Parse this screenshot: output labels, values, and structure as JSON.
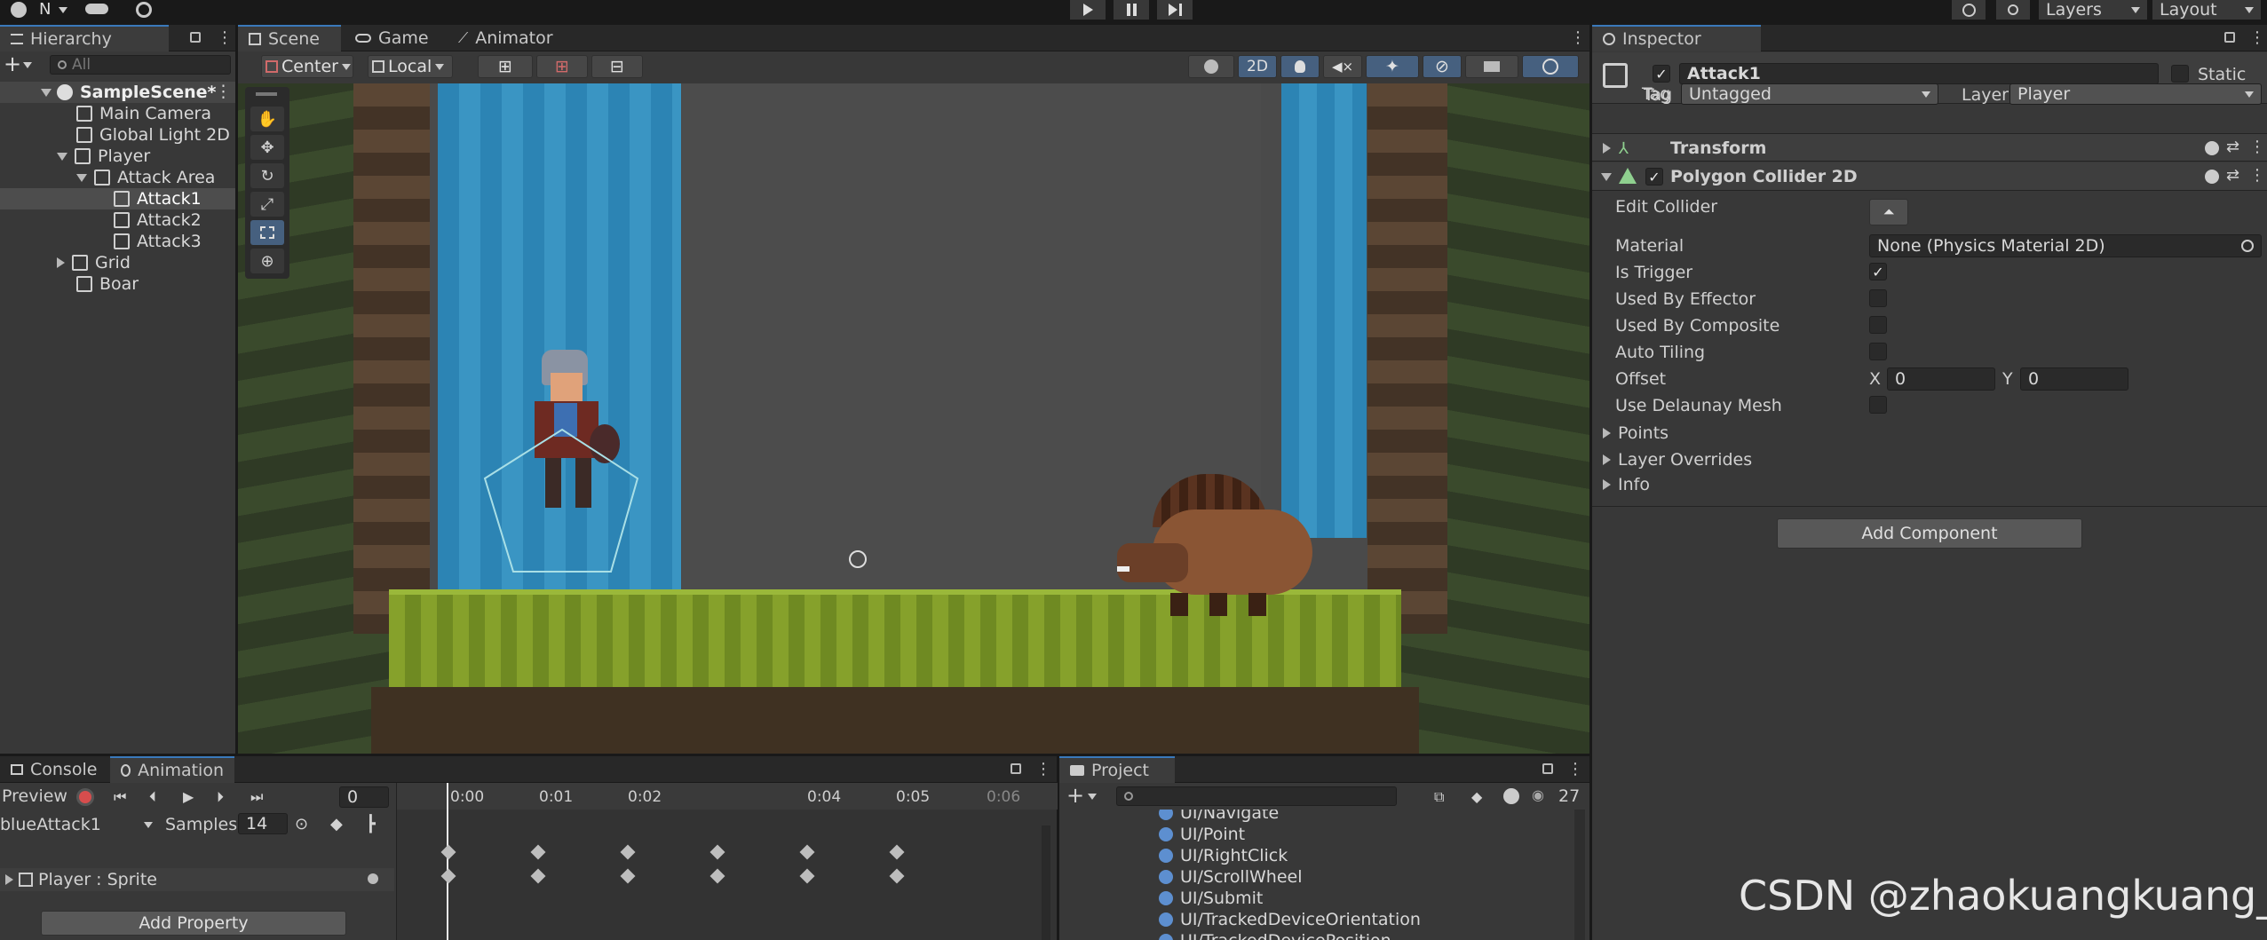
{
  "toolbar": {
    "account": "N",
    "layers": "Layers",
    "layout": "Layout"
  },
  "hierarchy": {
    "title": "Hierarchy",
    "search_placeholder": "All",
    "items": [
      {
        "label": "SampleScene*"
      },
      {
        "label": "Main Camera"
      },
      {
        "label": "Global Light 2D"
      },
      {
        "label": "Player"
      },
      {
        "label": "Attack Area"
      },
      {
        "label": "Attack1"
      },
      {
        "label": "Attack2"
      },
      {
        "label": "Attack3"
      },
      {
        "label": "Grid"
      },
      {
        "label": "Boar"
      }
    ]
  },
  "scene": {
    "tabs": [
      "Scene",
      "Game",
      "Animator"
    ],
    "pivot": "Center",
    "space": "Local",
    "mode2d": "2D"
  },
  "inspector": {
    "title": "Inspector",
    "object_name": "Attack1",
    "static_label": "Static",
    "tag_label": "Tag",
    "tag_value": "Untagged",
    "layer_label": "Layer",
    "layer_value": "Player",
    "transform": "Transform",
    "collider": "Polygon Collider 2D",
    "edit_collider": "Edit Collider",
    "material_label": "Material",
    "material_value": "None (Physics Material 2D)",
    "is_trigger": "Is Trigger",
    "used_by_effector": "Used By Effector",
    "used_by_composite": "Used By Composite",
    "auto_tiling": "Auto Tiling",
    "offset_label": "Offset",
    "x_label": "X",
    "x_value": "0",
    "y_label": "Y",
    "y_value": "0",
    "use_delaunay": "Use Delaunay Mesh",
    "points": "Points",
    "layer_overrides": "Layer Overrides",
    "info": "Info",
    "add_component": "Add Component"
  },
  "animation": {
    "tabs": [
      "Console",
      "Animation"
    ],
    "preview": "Preview",
    "frame": "0",
    "clip": "blueAttack1",
    "samples_label": "Samples",
    "samples_value": "14",
    "times": [
      "0:00",
      "0:01",
      "0:02",
      "0:04",
      "0:05",
      "0:06"
    ],
    "property": "Player : Sprite",
    "add_property": "Add Property"
  },
  "project": {
    "title": "Project",
    "count": "27",
    "items": [
      "UI/Navigate",
      "UI/Point",
      "UI/RightClick",
      "UI/ScrollWheel",
      "UI/Submit",
      "UI/TrackedDeviceOrientation",
      "UI/TrackedDevicePosition"
    ]
  },
  "watermark": "CSDN @zhaokuangkuang_",
  "colors": {
    "accent": "#3a79bb",
    "panel": "#383838",
    "header": "#282828"
  }
}
